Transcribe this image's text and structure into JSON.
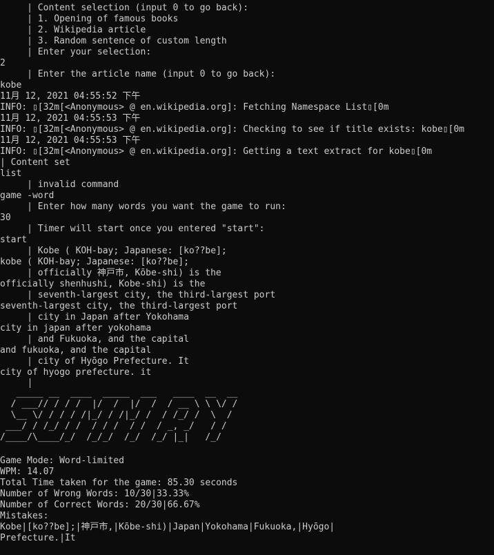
{
  "console": {
    "lines": [
      "     | Content selection (input 0 to go back):",
      "     | 1. Opening of famous books",
      "     | 2. Wikipedia article",
      "     | 3. Random sentence of custom length",
      "     | Enter your selection:",
      "2",
      "     | Enter the article name (input 0 to go back):",
      "kobe",
      "11月 12, 2021 04:55:52 下午",
      "INFO: ▯[32m[<Anonymous> @ en.wikipedia.org]: Fetching Namespace List▯[0m",
      "11月 12, 2021 04:55:53 下午",
      "INFO: ▯[32m[<Anonymous> @ en.wikipedia.org]: Checking to see if title exists: kobe▯[0m",
      "11月 12, 2021 04:55:53 下午",
      "INFO: ▯[32m[<Anonymous> @ en.wikipedia.org]: Getting a text extract for kobe▯[0m",
      "| Content set",
      "list",
      "     | invalid command",
      "game -word",
      "     | Enter how many words you want the game to run:",
      "30",
      "     | Timer will start once you entered \"start\":",
      "start",
      "     | Kobe ( KOH-bay; Japanese: [ko??be];",
      "kobe ( KOH-bay; Japanese: [ko??be];",
      "     | officially 神戸市, Kōbe-shi) is the",
      "officially shenhushi, Kobe-shi) is the",
      "     | seventh-largest city, the third-largest port",
      "seventh-largest city, the third-largest port",
      "     | city in Japan after Yokohama",
      "city in japan after yokohama",
      "     | and Fukuoka, and the capital",
      "and fukuoka, and the capital",
      "     | city of Hyōgo Prefecture. It",
      "city of hyogo prefecture. it"
    ]
  },
  "banner": {
    "art": "   _____ __  ____  _____  ___   ____  __  __\n  / ___// / / /  |/  /  |/  /  / __ \\ \\ \\/ /\n  \\__ \\/ / / / /|_/ / /|_/ /  / /_/ /  \\  / \n ___/ / /_/ / /  / / /  / /  / _, _/   / /  \n/____/\\____/_/  /_/_/  /_/  /_/ |_|   /_/   "
  },
  "stats": {
    "lines": [
      "Game Mode: Word-limited",
      "WPM: 14.07",
      "Total Time taken for the game: 85.30 seconds",
      "Number of Wrong Words: 10/30|33.33%",
      "Number of Correct Words: 20/30|66.67%",
      "Mistakes:",
      "Kobe|[ko??be];|神戸市,|Kōbe-shi)|Japan|Yokohama|Fukuoka,|Hyōgo|",
      "Prefecture.|It"
    ]
  }
}
